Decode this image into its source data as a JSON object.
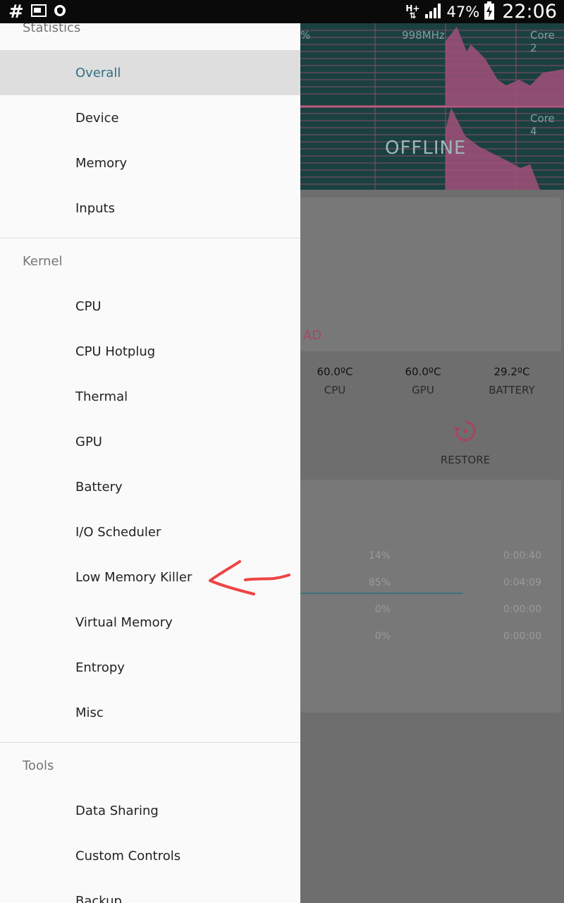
{
  "status_bar": {
    "hash_icon": "#",
    "network_type": "H+",
    "battery_percent": "47%",
    "time": "22:06"
  },
  "background": {
    "graph_label_left": "%",
    "graph_freq": "998MHz",
    "graph_core_top": "Core 2",
    "graph_core_bottom": "Core 4",
    "graph_status": "OFFLINE",
    "card_link_fragment": "AD",
    "temps": [
      {
        "value": "60.0ºC",
        "label": "CPU"
      },
      {
        "value": "60.0ºC",
        "label": "GPU"
      },
      {
        "value": "29.2ºC",
        "label": "BATTERY"
      }
    ],
    "restore_label": "RESTORE",
    "stats": [
      {
        "percent": "14%",
        "time": "0:00:40"
      },
      {
        "percent": "85%",
        "time": "0:04:09"
      },
      {
        "percent": "0%",
        "time": "0:00:00"
      },
      {
        "percent": "0%",
        "time": "0:00:00"
      }
    ],
    "accent_color": "#e0507a"
  },
  "drawer": {
    "sections": [
      {
        "header": "Statistics",
        "items": [
          "Overall",
          "Device",
          "Memory",
          "Inputs"
        ]
      },
      {
        "header": "Kernel",
        "items": [
          "CPU",
          "CPU Hotplug",
          "Thermal",
          "GPU",
          "Battery",
          "I/O Scheduler",
          "Low Memory Killer",
          "Virtual Memory",
          "Entropy",
          "Misc"
        ]
      },
      {
        "header": "Tools",
        "items": [
          "Data Sharing",
          "Custom Controls",
          "Backup"
        ]
      }
    ],
    "active_item": "Overall",
    "active_color": "#2f6f80"
  }
}
